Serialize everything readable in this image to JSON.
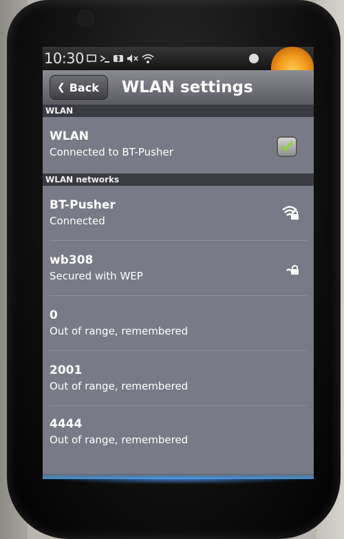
{
  "status_bar": {
    "time": "10:30"
  },
  "title_bar": {
    "back_label": "Back",
    "title": "WLAN settings"
  },
  "sections": {
    "wlan_header": "WLAN",
    "networks_header": "WLAN networks"
  },
  "wlan_toggle": {
    "title": "WLAN",
    "summary": "Connected to BT-Pusher",
    "checked": true
  },
  "networks": [
    {
      "name": "BT-Pusher",
      "status": "Connected",
      "icon": "wifi-lock-strong-icon"
    },
    {
      "name": "wb308",
      "status": "Secured with WEP",
      "icon": "wifi-lock-weak-icon"
    },
    {
      "name": "0",
      "status": "Out of range, remembered"
    },
    {
      "name": "2001",
      "status": "Out of range, remembered"
    },
    {
      "name": "4444",
      "status": "Out of range, remembered"
    }
  ],
  "colors": {
    "screen_bg": "#797a87",
    "section_header_bg": "#3a3b42",
    "checkbox_check": "#8bd13a"
  }
}
